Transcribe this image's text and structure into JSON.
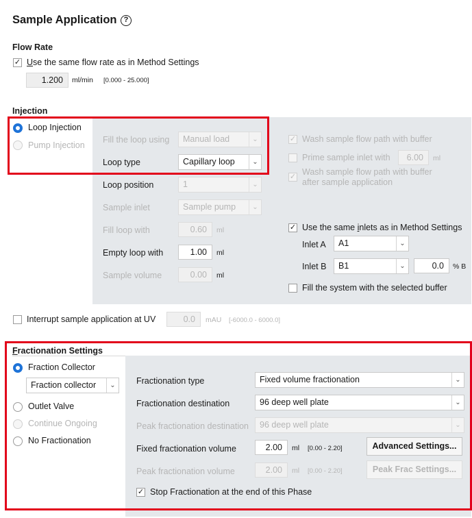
{
  "header": {
    "title": "Sample Application",
    "help_icon": "?"
  },
  "flow_rate": {
    "title": "Flow Rate",
    "use_same_label_pre": "",
    "use_same_label_underlined": "U",
    "use_same_label_rest": "se the same flow rate as in Method Settings",
    "use_same_checked": true,
    "value": "1.200",
    "unit": "ml/min",
    "range": "[0.000 - 25.000]"
  },
  "injection": {
    "title": "Injection",
    "loop_injection": "Loop Injection",
    "pump_injection": "Pump Injection",
    "fill_loop_using_label": "Fill the loop using",
    "fill_loop_using_value": "Manual load",
    "loop_type_label": "Loop type",
    "loop_type_value": "Capillary loop",
    "loop_position_label": "Loop position",
    "loop_position_value": "1",
    "sample_inlet_label": "Sample inlet",
    "sample_inlet_value": "Sample pump",
    "fill_loop_with_label": "Fill loop with",
    "fill_loop_with_value": "0.60",
    "fill_loop_with_unit": "ml",
    "empty_loop_with_label": "Empty loop with",
    "empty_loop_with_value": "1.00",
    "empty_loop_with_unit": "ml",
    "sample_volume_label": "Sample volume",
    "sample_volume_value": "0.00",
    "sample_volume_unit": "ml",
    "wash_label": "Wash sample flow path with buffer",
    "prime_label": "Prime sample inlet with",
    "prime_value": "6.00",
    "prime_unit": "ml",
    "wash_after_label_1": "Wash sample flow path with buffer",
    "wash_after_label_2": "after sample application",
    "same_inlets_pre": "Use the same ",
    "same_inlets_u": "i",
    "same_inlets_rest": "nlets as in Method Settings",
    "inlet_a_label": "Inlet A",
    "inlet_a_value": "A1",
    "inlet_b_label": "Inlet B",
    "inlet_b_value": "B1",
    "inlet_b_percent": "0.0",
    "percent_unit": "% B",
    "fill_system_label": "Fill the system with the selected buffer"
  },
  "interrupt": {
    "label": "Interrupt sample application at UV",
    "value": "0.0",
    "unit": "mAU",
    "range": "[-6000.0 - 6000.0]"
  },
  "fractionation": {
    "title_u": "F",
    "title_rest": "ractionation Settings",
    "fraction_collector": "Fraction Collector",
    "fraction_collector_combo": "Fraction collector",
    "outlet_valve": "Outlet Valve",
    "continue_ongoing": "Continue Ongoing",
    "no_fractionation": "No Fractionation",
    "type_label": "Fractionation type",
    "type_value": "Fixed volume fractionation",
    "destination_label": "Fractionation destination",
    "destination_value": "96 deep well plate",
    "peak_destination_label": "Peak fractionation destination",
    "peak_destination_value": "96 deep well plate",
    "fixed_volume_label": "Fixed fractionation volume",
    "fixed_volume_value": "2.00",
    "fixed_volume_unit": "ml",
    "fixed_volume_range": "[0.00 - 2.20]",
    "advanced_button": "Advanced Settings...",
    "peak_volume_label": "Peak fractionation volume",
    "peak_volume_value": "2.00",
    "peak_volume_unit": "ml",
    "peak_volume_range": "[0.00 - 2.20]",
    "peak_frac_button": "Peak Frac Settings...",
    "stop_label": "Stop Fractionation at the end of this Phase"
  },
  "colors": {
    "accent": "#1e73d8",
    "highlight": "#e2001a",
    "panel": "#e5e8eb"
  }
}
